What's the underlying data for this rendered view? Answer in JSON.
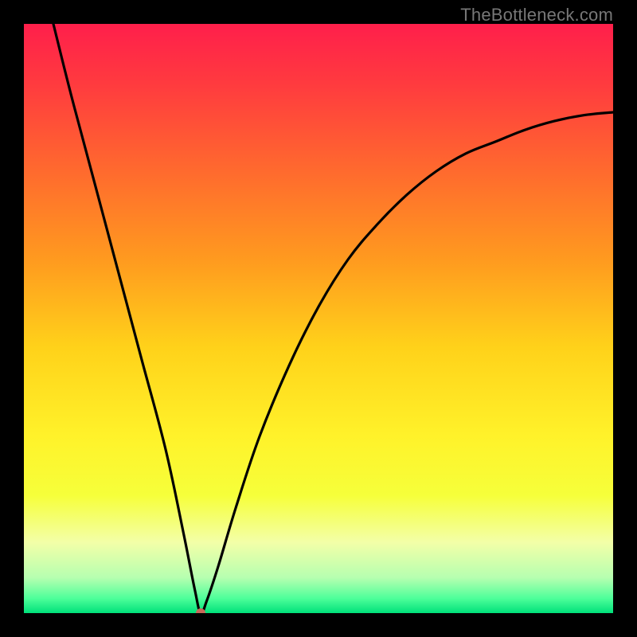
{
  "watermark": "TheBottleneck.com",
  "chart_data": {
    "type": "line",
    "title": "",
    "xlabel": "",
    "ylabel": "",
    "xlim": [
      0,
      100
    ],
    "ylim": [
      0,
      100
    ],
    "grid": false,
    "legend": false,
    "background": "rainbow-gradient-vertical",
    "notes": "Bottleneck-style V curve. X axis roughly parameterizes relative component strength; Y axis is bottleneck severity (0 = optimal). Minimum at x≈30, y≈0. Left branch near-vertical from the top-left corner down to the minimum; right branch rises with diminishing slope toward the top-right. Small coral marker at the minimum.",
    "series": [
      {
        "name": "bottleneck-curve",
        "x": [
          5,
          8,
          12,
          16,
          20,
          24,
          27,
          29,
          30,
          31,
          33,
          36,
          40,
          45,
          50,
          55,
          60,
          65,
          70,
          75,
          80,
          85,
          90,
          95,
          100
        ],
        "y": [
          100,
          88,
          73,
          58,
          43,
          28,
          14,
          4,
          0,
          2,
          8,
          18,
          30,
          42,
          52,
          60,
          66,
          71,
          75,
          78,
          80,
          82,
          83.5,
          84.5,
          85
        ]
      }
    ],
    "marker": {
      "x": 30,
      "y": 0,
      "color": "#c86a5a",
      "radius_px": 6
    },
    "gradient_stops": [
      {
        "offset": 0.0,
        "color": "#ff1f4b"
      },
      {
        "offset": 0.1,
        "color": "#ff3a3f"
      },
      {
        "offset": 0.25,
        "color": "#ff6a2e"
      },
      {
        "offset": 0.4,
        "color": "#ff9a1f"
      },
      {
        "offset": 0.55,
        "color": "#ffd21a"
      },
      {
        "offset": 0.7,
        "color": "#fff22a"
      },
      {
        "offset": 0.8,
        "color": "#f6ff3a"
      },
      {
        "offset": 0.88,
        "color": "#f3ffa8"
      },
      {
        "offset": 0.94,
        "color": "#b6ffb0"
      },
      {
        "offset": 0.975,
        "color": "#4eff9a"
      },
      {
        "offset": 1.0,
        "color": "#00e07a"
      }
    ]
  }
}
